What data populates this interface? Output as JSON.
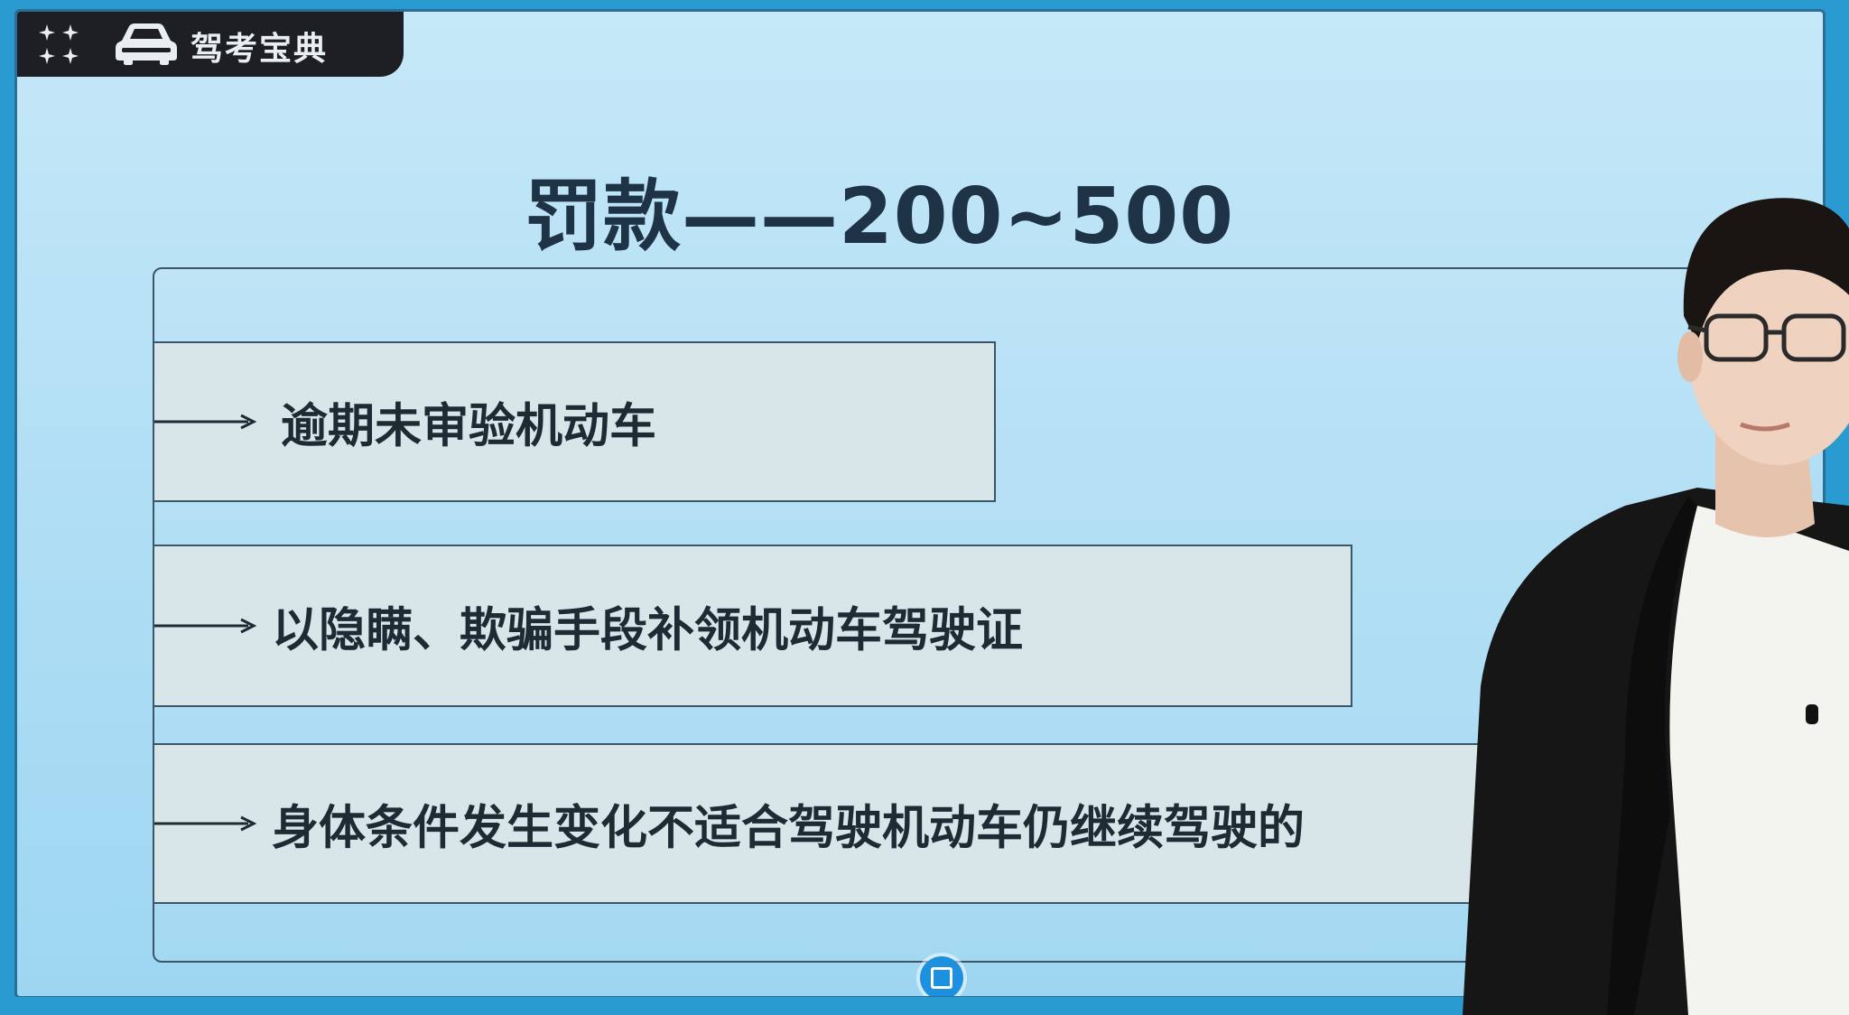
{
  "app": {
    "logo_text": "驾考宝典"
  },
  "slide": {
    "title": "罚款——200~500",
    "items": [
      {
        "text": "逾期未审验机动车"
      },
      {
        "text": "以隐瞒、欺骗手段补领机动车驾驶证"
      },
      {
        "text": "身体条件发生变化不适合驾驶机动车仍继续驾驶的"
      }
    ]
  },
  "icons": {
    "grid": "grid-icon",
    "car": "car-icon",
    "stop": "stop-record-icon",
    "arrow": "arrow-right-icon"
  },
  "colors": {
    "accent": "#1e90e0",
    "slide_bg": "#b2dff5",
    "title": "#1f3346",
    "row_bg": "#d8e6ea",
    "logo_bar": "#1d1f24"
  }
}
